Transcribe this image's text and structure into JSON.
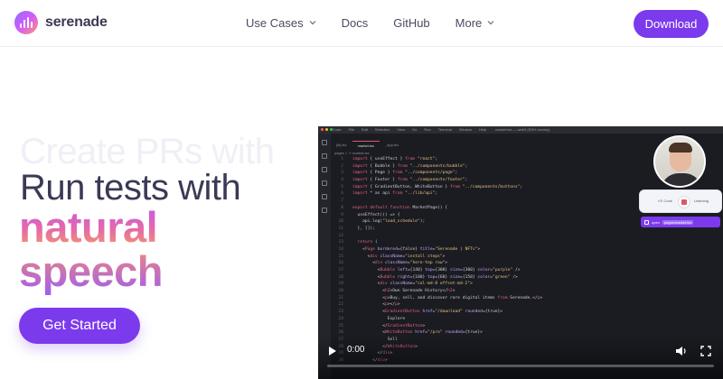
{
  "brand": {
    "name": "serenade",
    "accent": "#7c3aed"
  },
  "nav": {
    "items": [
      {
        "label": "Use Cases",
        "has_dropdown": true
      },
      {
        "label": "Docs",
        "has_dropdown": false
      },
      {
        "label": "GitHub",
        "has_dropdown": false
      },
      {
        "label": "More",
        "has_dropdown": true
      }
    ],
    "download_label": "Download"
  },
  "hero": {
    "ghost_text": "Create PRs with",
    "line1": "Run tests with",
    "line2": "natural",
    "line3": "speech",
    "cta_label": "Get Started"
  },
  "video": {
    "time": "0:00",
    "progress": 0,
    "editor": {
      "app": "Code",
      "menu": [
        "File",
        "Edit",
        "Selection",
        "View",
        "Go",
        "Run",
        "Terminal",
        "Window",
        "Help"
      ],
      "window_title": "market.tsx — web3 (SSH: tommy)",
      "tabs": [
        "[id].tsx",
        "market.tsx",
        "_app.tsx"
      ],
      "active_tab": 1,
      "breadcrumb": "pages > ⚛ market.tsx",
      "code_lines": [
        "import { useEffect } from \"react\";",
        "import { Bubble } from \"../components/bubble\";",
        "import { Page } from \"../components/page\";",
        "import { Footer } from \"../components/footer\";",
        "import { GradientButton, WhiteButton } from \"../components/buttons\";",
        "import * as api from \"../lib/api\";",
        "",
        "export default function MarketPage() {",
        "  useEffect(() => {",
        "    api.log(\"load_schedule\");",
        "  }, []);",
        "",
        "  return (",
        "    <Page bordered={false} title=\"Serenade | NFTs\">",
        "      <div className=\"install steps\">",
        "        <div className=\"hero-top row\">",
        "          <Bubble left={140} top={300} size={300} color=\"purple\" />",
        "          <Bubble right={180} top={60} size={150} color=\"green\" />",
        "          <div className=\"col-md-8 offset-md-2\">",
        "            <h2>Own Serenade History</h2>",
        "            <p>Buy, sell, and discover rare digital items from Serenade.</p>",
        "            <p></p>",
        "            <GradientButton href=\"/download\" rounded={true}>",
        "              Explore",
        "            </GradientButton>",
        "            <WhiteButton href=\"/pro\" rounded={true}>",
        "              Sell",
        "            </WhiteButton>",
        "          </div>",
        "        </div>"
      ],
      "overlay": {
        "status": "Listening",
        "mode": "VS Code",
        "command_prefix": "open",
        "command_path": "pages/market.tsx"
      }
    }
  }
}
